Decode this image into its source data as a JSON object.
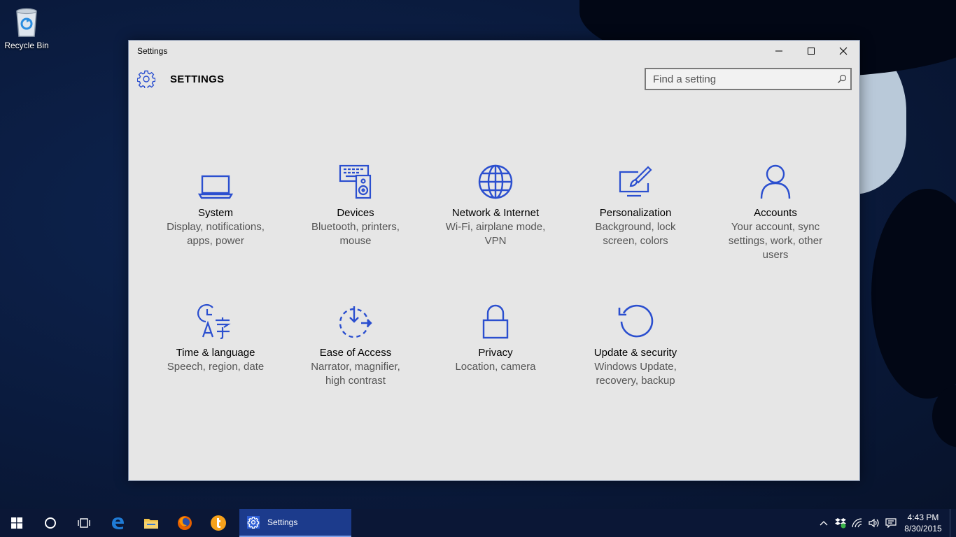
{
  "desktop": {
    "icons": [
      {
        "label": "Recycle Bin",
        "icon": "recycle-bin-icon"
      }
    ]
  },
  "window": {
    "title": "Settings",
    "controls": {
      "minimize": "minimize-icon",
      "maximize": "maximize-icon",
      "close": "close-icon"
    }
  },
  "header": {
    "title": "SETTINGS",
    "search_placeholder": "Find a setting"
  },
  "categories": [
    {
      "name": "System",
      "desc1": "Display, notifications,",
      "desc2": "apps, power",
      "desc3": "",
      "icon": "laptop-icon"
    },
    {
      "name": "Devices",
      "desc1": "Bluetooth, printers,",
      "desc2": "mouse",
      "desc3": "",
      "icon": "devices-icon"
    },
    {
      "name": "Network & Internet",
      "desc1": "Wi-Fi, airplane mode,",
      "desc2": "VPN",
      "desc3": "",
      "icon": "globe-icon"
    },
    {
      "name": "Personalization",
      "desc1": "Background, lock",
      "desc2": "screen, colors",
      "desc3": "",
      "icon": "paint-monitor-icon"
    },
    {
      "name": "Accounts",
      "desc1": "Your account, sync",
      "desc2": "settings, work, other",
      "desc3": "users",
      "icon": "person-icon"
    },
    {
      "name": "Time & language",
      "desc1": "Speech, region, date",
      "desc2": "",
      "desc3": "",
      "icon": "time-language-icon"
    },
    {
      "name": "Ease of Access",
      "desc1": "Narrator, magnifier,",
      "desc2": "high contrast",
      "desc3": "",
      "icon": "ease-of-access-icon"
    },
    {
      "name": "Privacy",
      "desc1": "Location, camera",
      "desc2": "",
      "desc3": "",
      "icon": "lock-icon"
    },
    {
      "name": "Update & security",
      "desc1": "Windows Update,",
      "desc2": "recovery, backup",
      "desc3": "",
      "icon": "refresh-icon"
    }
  ],
  "taskbar": {
    "active_app": "Settings",
    "clock_time": "4:43 PM",
    "clock_date": "8/30/2015"
  },
  "colors": {
    "accent": "#2b4fcf",
    "taskbar": "#0b1736",
    "window_bg": "#e6e6e6"
  }
}
